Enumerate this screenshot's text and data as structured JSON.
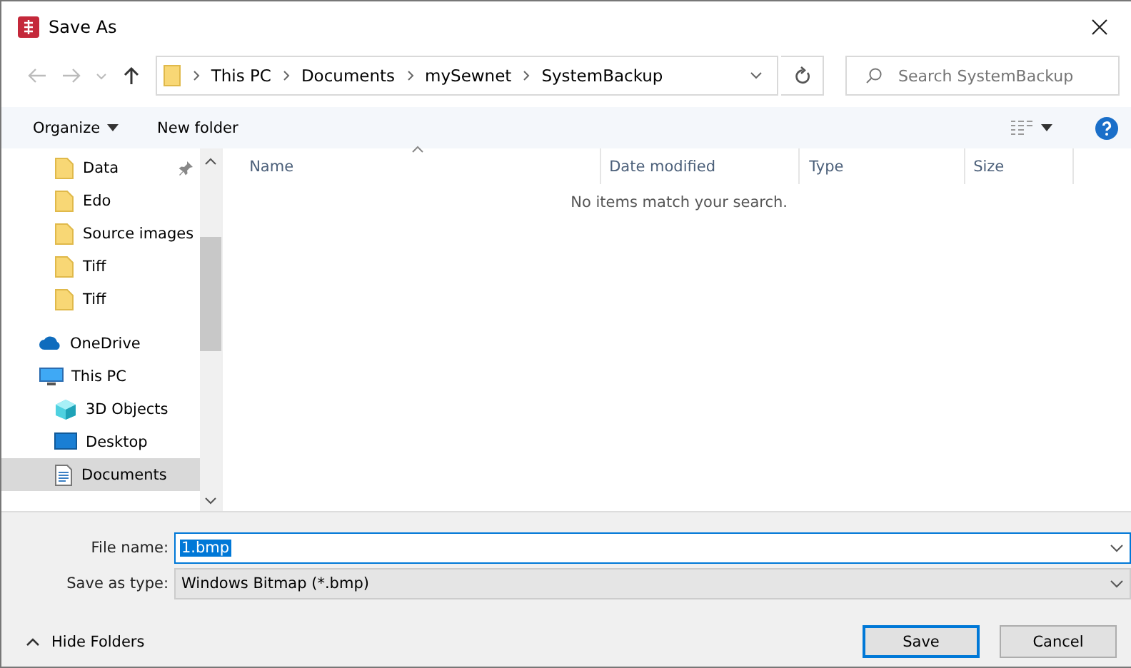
{
  "window": {
    "title": "Save As"
  },
  "address_bar": {
    "path": [
      "This PC",
      "Documents",
      "mySewnet",
      "SystemBackup"
    ]
  },
  "search": {
    "placeholder": "Search SystemBackup"
  },
  "toolbar": {
    "organize": "Organize",
    "new_folder": "New folder"
  },
  "sidebar": {
    "items": [
      {
        "label": "Data",
        "kind": "folder",
        "pinned": true,
        "selected": false
      },
      {
        "label": "Edo",
        "kind": "folder",
        "pinned": false,
        "selected": false
      },
      {
        "label": "Source images",
        "kind": "folder",
        "pinned": false,
        "selected": false
      },
      {
        "label": "Tiff",
        "kind": "folder",
        "pinned": false,
        "selected": false
      },
      {
        "label": "Tiff",
        "kind": "folder",
        "pinned": false,
        "selected": false
      },
      {
        "label": "OneDrive",
        "kind": "cloud",
        "pinned": false,
        "selected": false
      },
      {
        "label": "This PC",
        "kind": "computer",
        "pinned": false,
        "selected": false,
        "children": [
          {
            "label": "3D Objects",
            "kind": "cube",
            "pinned": false,
            "selected": false
          },
          {
            "label": "Desktop",
            "kind": "desktop",
            "pinned": false,
            "selected": false
          },
          {
            "label": "Documents",
            "kind": "document",
            "pinned": false,
            "selected": true
          }
        ]
      }
    ]
  },
  "table": {
    "columns": [
      {
        "label": "Name",
        "sorted": true
      },
      {
        "label": "Date modified",
        "sorted": false
      },
      {
        "label": "Type",
        "sorted": false
      },
      {
        "label": "Size",
        "sorted": false
      }
    ],
    "empty_message": "No items match your search."
  },
  "file_name": {
    "label": "File name:",
    "value": "1.bmp"
  },
  "save_as_type": {
    "label": "Save as type:",
    "value": "Windows Bitmap (*.bmp)"
  },
  "hide_folders": "Hide Folders",
  "buttons": [
    "Save",
    "Cancel"
  ]
}
